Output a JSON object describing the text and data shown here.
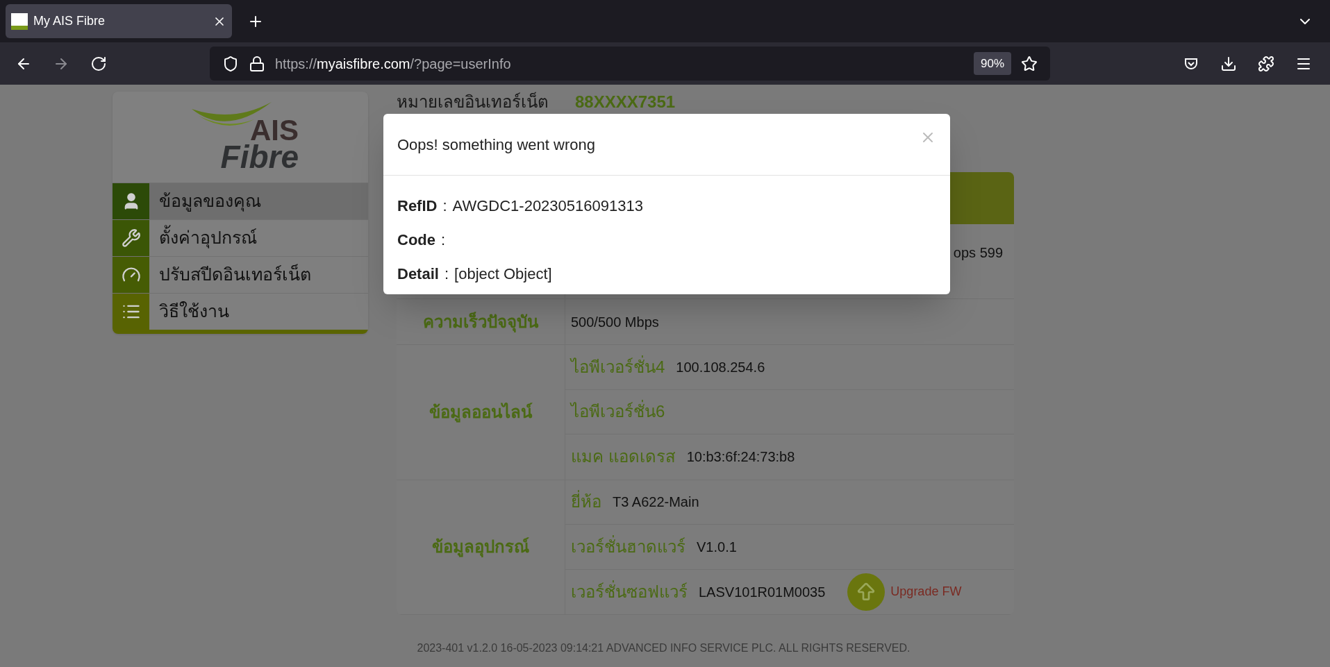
{
  "browser": {
    "tabs": [
      {
        "title": "My AIS Fibre",
        "selected": true
      }
    ],
    "url": {
      "scheme": "https://",
      "host": "myaisfibre.com",
      "path": "/?page=userInfo"
    },
    "zoom": "90%"
  },
  "sidebar": {
    "logo": {
      "top": "AIS",
      "bottom": "Fibre"
    },
    "items": [
      {
        "kind": "user",
        "label": "ข้อมูลของคุณ",
        "selected": true
      },
      {
        "kind": "wrench",
        "label": "ตั้งค่าอุปกรณ์",
        "selected": false
      },
      {
        "kind": "gauge",
        "label": "ปรับสปีดอินเทอร์เน็ต",
        "selected": false
      },
      {
        "kind": "list",
        "label": "วิธีใช้งาน",
        "selected": false
      }
    ]
  },
  "internet_number": {
    "label": "หมายเลขอินเทอร์เน็ต",
    "value": "88XXXX7351"
  },
  "table": {
    "sections": [
      {
        "rows": [
          {
            "value": "ops 599"
          }
        ]
      },
      {
        "label": "ความเร็วปัจจุบัน",
        "rows": [
          {
            "value": "500/500 Mbps"
          }
        ]
      },
      {
        "label": "ข้อมูลออนไลน์",
        "rows": [
          {
            "name": "ไอพีเวอร์ชั่น4",
            "value": "100.108.254.6"
          },
          {
            "name": "ไอพีเวอร์ชั่น6"
          },
          {
            "name": "แมค แอดเดรส",
            "value": "10:b3:6f:24:73:b8"
          }
        ]
      },
      {
        "label": "ข้อมูลอุปกรณ์",
        "rows": [
          {
            "name": "ยี่ห้อ",
            "value": "T3 A622-Main"
          },
          {
            "name": "เวอร์ชั่นฮาดแวร์",
            "value": "V1.0.1"
          },
          {
            "name": "เวอร์ชั่นซอฟแวร์",
            "value": "LASV101R01M0035",
            "action": "Upgrade FW"
          }
        ]
      }
    ]
  },
  "dialog": {
    "title": "Oops! something went wrong",
    "fields": [
      {
        "label": "RefID",
        "sep": ":",
        "value": "AWGDC1-20230516091313"
      },
      {
        "label": "Code",
        "sep": ":"
      },
      {
        "label": "Detail",
        "sep": ":",
        "value": "[object Object]"
      }
    ]
  },
  "footer": "2023-401 v1.2.0 16-05-2023 09:14:21 ADVANCED INFO SERVICE PLC. ALL RIGHTS RESERVED."
}
